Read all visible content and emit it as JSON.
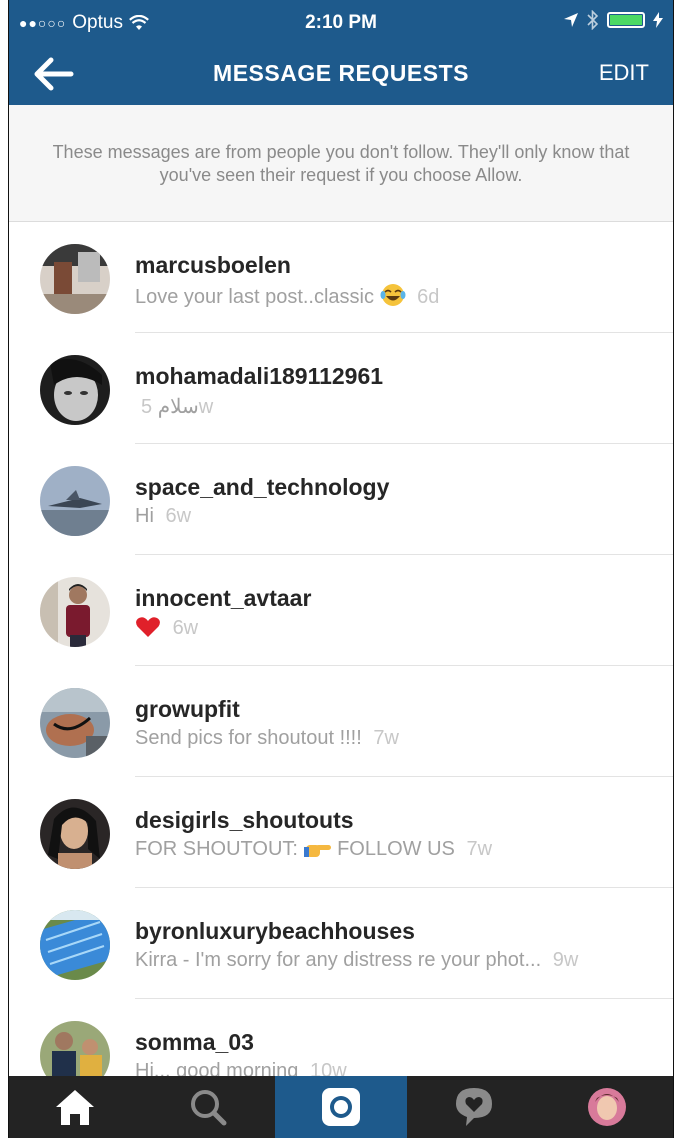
{
  "status_bar": {
    "carrier": "Optus",
    "time": "2:10 PM",
    "signal_dots": "●●○○○"
  },
  "header": {
    "title": "MESSAGE REQUESTS",
    "edit_label": "EDIT",
    "back_icon": "back-arrow-icon"
  },
  "notice": {
    "text": "These messages are from people you don't follow. They'll only know that you've seen their request if you choose Allow."
  },
  "requests": [
    {
      "username": "marcusboelen",
      "message": "Love your last post..classic",
      "emoji": "laughing-tears-emoji",
      "age": "6d"
    },
    {
      "username": "mohamadali189112961",
      "message": "سلام",
      "age": "5w"
    },
    {
      "username": "space_and_technology",
      "message": "Hi",
      "age": "6w"
    },
    {
      "username": "innocent_avtaar",
      "message": "",
      "emoji": "red-heart-emoji",
      "age": "6w"
    },
    {
      "username": "growupfit",
      "message": "Send pics for shoutout !!!!",
      "age": "7w"
    },
    {
      "username": "desigirls_shoutouts",
      "message_prefix": "FOR SHOUTOUT:",
      "emoji": "pointing-hand-emoji",
      "message": "FOLLOW US",
      "age": "7w"
    },
    {
      "username": "byronluxurybeachhouses",
      "message": "Kirra - I'm sorry for any distress re your phot...",
      "age": "9w"
    },
    {
      "username": "somma_03",
      "message": "Hi... good morning",
      "age": "10w"
    }
  ],
  "tabbar": {
    "tabs": [
      "home-icon",
      "search-icon",
      "camera-icon",
      "activity-icon",
      "profile-icon"
    ],
    "active_index": 2
  },
  "colors": {
    "brand": "#1e5a8c",
    "tabbar": "#232323",
    "username": "#262626",
    "message": "#a0a0a0"
  }
}
